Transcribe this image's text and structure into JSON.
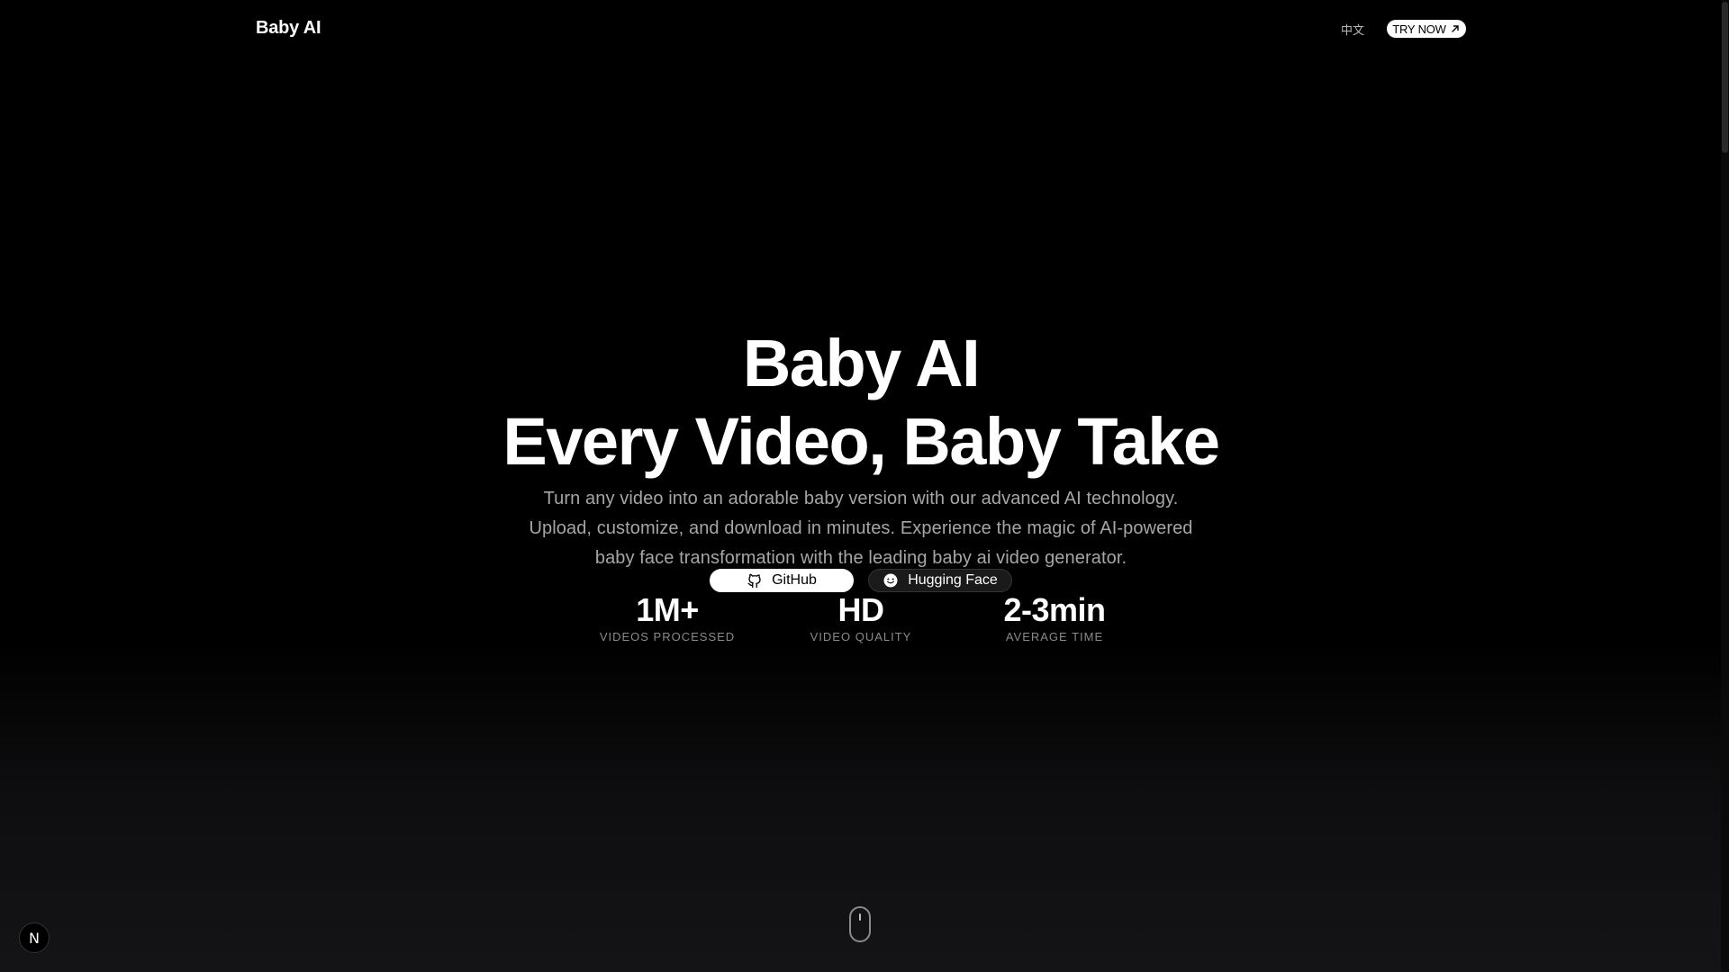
{
  "header": {
    "brand": "Baby AI",
    "lang_link": "中文",
    "cta_label": "TRY NOW",
    "cta_icon": "arrow-up-right-icon"
  },
  "hero": {
    "title_line1": "Baby AI",
    "title_line2": "Every Video, Baby Take",
    "description": "Turn any video into an adorable baby version with our advanced AI technology. Upload, customize, and download in minutes. Experience the magic of AI-powered baby face transformation with the leading baby ai video generator.",
    "buttons": [
      {
        "label": "GitHub",
        "icon": "github-icon"
      },
      {
        "label": "Hugging Face",
        "icon": "hugging-face-icon"
      }
    ]
  },
  "stats": [
    {
      "value": "1M+",
      "label": "VIDEOS PROCESSED"
    },
    {
      "value": "HD",
      "label": "VIDEO QUALITY"
    },
    {
      "value": "2-3min",
      "label": "AVERAGE TIME"
    }
  ],
  "footer": {
    "scroll_indicator_icon": "mouse-scroll-icon",
    "framework_badge": "N"
  },
  "colors": {
    "background": "#000000",
    "text_primary": "#ffffff",
    "text_muted": "#a6a6a6",
    "button_light": "#ffffff",
    "button_dark": "#1a1a1a"
  }
}
